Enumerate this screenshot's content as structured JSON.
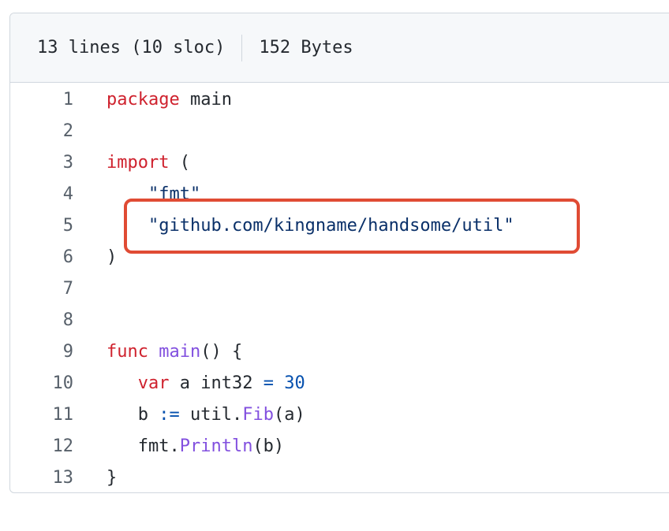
{
  "file_info": {
    "lines_summary": "13 lines (10 sloc)",
    "size": "152 Bytes"
  },
  "code_lines": [
    {
      "n": "1",
      "tokens": [
        {
          "t": "package",
          "c": "kw"
        },
        {
          "t": " main",
          "c": ""
        }
      ]
    },
    {
      "n": "2",
      "tokens": []
    },
    {
      "n": "3",
      "tokens": [
        {
          "t": "import",
          "c": "kw"
        },
        {
          "t": " (",
          "c": ""
        }
      ]
    },
    {
      "n": "4",
      "tokens": [
        {
          "t": "    \"fmt\"",
          "c": "str"
        }
      ]
    },
    {
      "n": "5",
      "tokens": [
        {
          "t": "    \"github.com/kingname/handsome/util\"",
          "c": "str"
        }
      ]
    },
    {
      "n": "6",
      "tokens": [
        {
          "t": ")",
          "c": ""
        }
      ]
    },
    {
      "n": "7",
      "tokens": []
    },
    {
      "n": "8",
      "tokens": []
    },
    {
      "n": "9",
      "tokens": [
        {
          "t": "func",
          "c": "kw"
        },
        {
          "t": " ",
          "c": ""
        },
        {
          "t": "main",
          "c": "fn"
        },
        {
          "t": "() {",
          "c": ""
        }
      ]
    },
    {
      "n": "10",
      "tokens": [
        {
          "t": "   ",
          "c": ""
        },
        {
          "t": "var",
          "c": "kw"
        },
        {
          "t": " a int32 ",
          "c": ""
        },
        {
          "t": "=",
          "c": "op"
        },
        {
          "t": " ",
          "c": ""
        },
        {
          "t": "30",
          "c": "num"
        }
      ]
    },
    {
      "n": "11",
      "tokens": [
        {
          "t": "   b ",
          "c": ""
        },
        {
          "t": ":=",
          "c": "op"
        },
        {
          "t": " util.",
          "c": ""
        },
        {
          "t": "Fib",
          "c": "fn"
        },
        {
          "t": "(a)",
          "c": ""
        }
      ]
    },
    {
      "n": "12",
      "tokens": [
        {
          "t": "   fmt.",
          "c": ""
        },
        {
          "t": "Println",
          "c": "fn"
        },
        {
          "t": "(b)",
          "c": ""
        }
      ]
    },
    {
      "n": "13",
      "tokens": [
        {
          "t": "}",
          "c": ""
        }
      ]
    }
  ],
  "colors": {
    "keyword": "#cf222e",
    "function": "#8250df",
    "string": "#0a3069",
    "number": "#0550ae",
    "highlight_box": "#e04b34"
  }
}
